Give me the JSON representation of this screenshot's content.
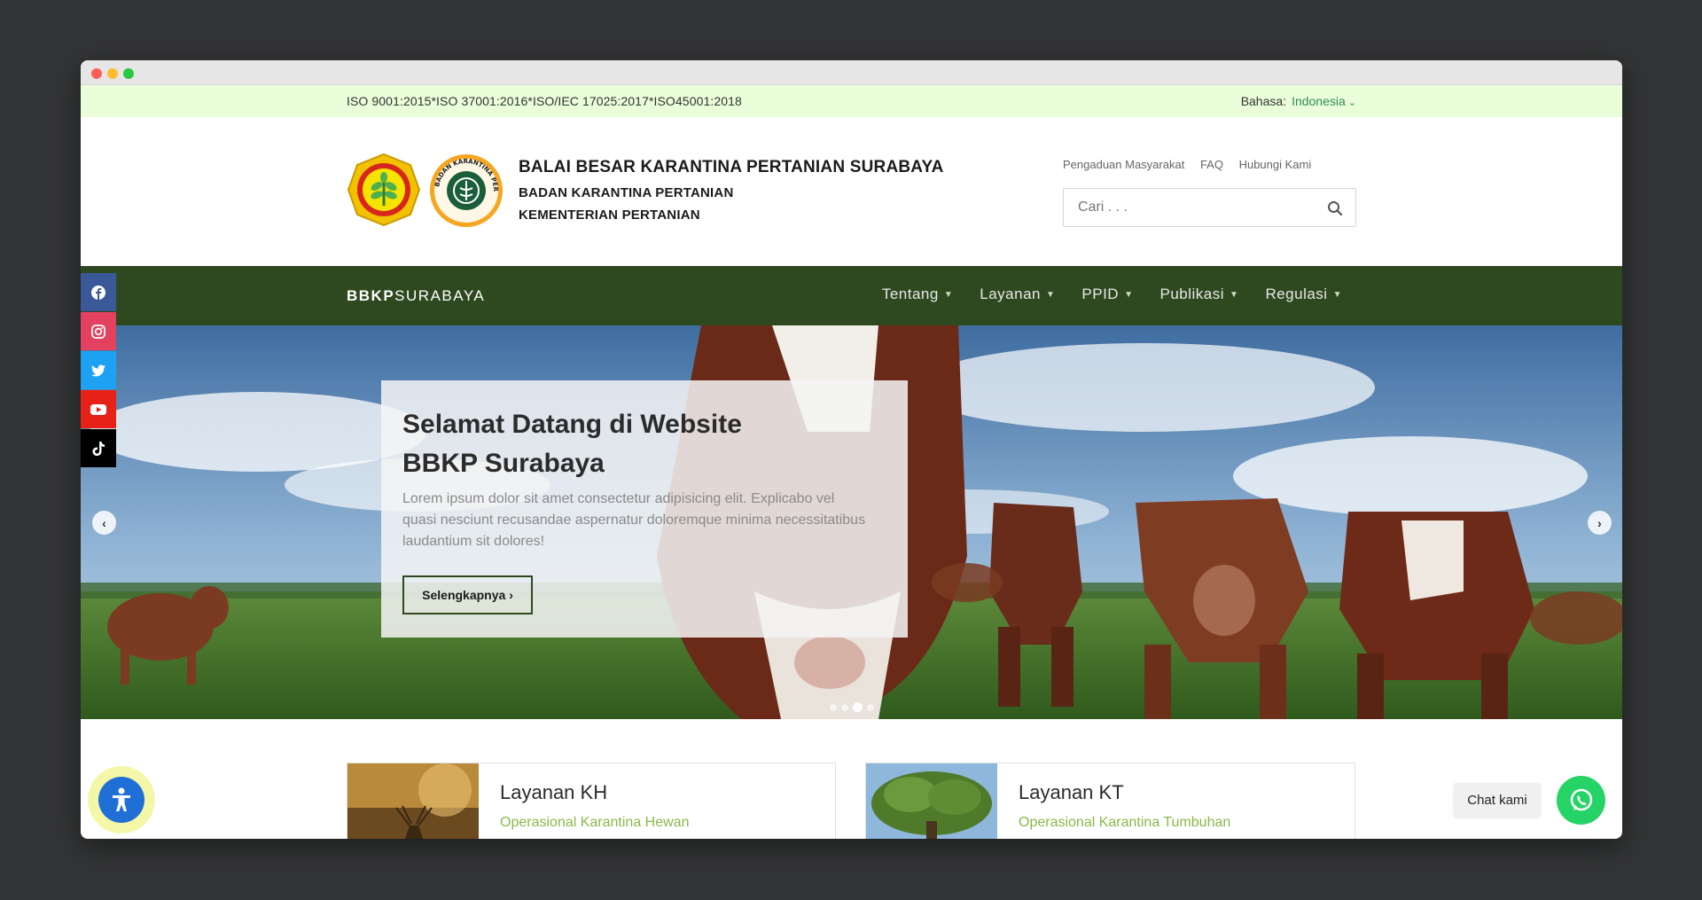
{
  "topbar": {
    "iso": "ISO 9001:2015*ISO 37001:2016*ISO/IEC 17025:2017*ISO45001:2018",
    "language_label": "Bahasa:",
    "language_value": "Indonesia"
  },
  "header": {
    "org_main": "BALAI BESAR KARANTINA PERTANIAN SURABAYA",
    "org_sub": "BADAN KARANTINA PERTANIAN",
    "org_sub2": "KEMENTERIAN PERTANIAN",
    "logo2_text": "BADAN KARANTINA PERTANIAN",
    "links": [
      "Pengaduan Masyarakat",
      "FAQ",
      "Hubungi Kami"
    ],
    "search_placeholder": "Cari . . ."
  },
  "navbar": {
    "brand_bold": "BBKP",
    "brand_light": "SURABAYA",
    "items": [
      "Tentang",
      "Layanan",
      "PPID",
      "Publikasi",
      "Regulasi"
    ]
  },
  "social": [
    "facebook-icon",
    "instagram-icon",
    "twitter-icon",
    "youtube-icon",
    "tiktok-icon"
  ],
  "hero": {
    "title": "Selamat Datang di Website BBKP Surabaya",
    "text": "Lorem ipsum dolor sit amet consectetur adipisicing elit. Explicabo vel quasi nesciunt recusandae aspernatur doloremque minima necessitatibus laudantium sit dolores!",
    "button": "Selengkapnya",
    "slides": 4,
    "active_slide": 3
  },
  "services": [
    {
      "title": "Layanan KH",
      "subtitle": "Operasional Karantina Hewan"
    },
    {
      "title": "Layanan KT",
      "subtitle": "Operasional Karantina Tumbuhan"
    }
  ],
  "chat": {
    "label": "Chat kami"
  },
  "colors": {
    "nav_bg": "#2e4920",
    "topbar_bg": "#eafed9",
    "accent_green": "#8ab84a",
    "whatsapp": "#25d366"
  }
}
